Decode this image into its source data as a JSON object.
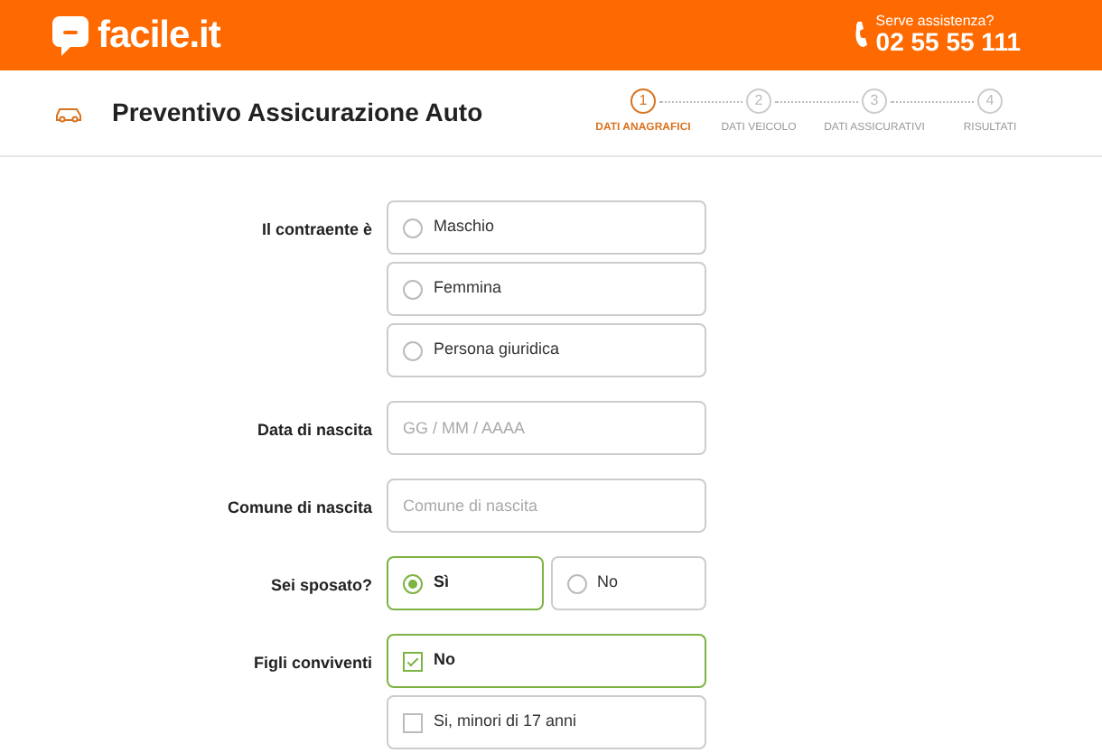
{
  "header": {
    "logo": "facile.it",
    "help_label": "Serve assistenza?",
    "phone": "02 55 55 111"
  },
  "page_title": "Preventivo Assicurazione Auto",
  "steps": [
    {
      "number": "1",
      "label": "DATI ANAGRAFICI",
      "selected": true
    },
    {
      "number": "2",
      "label": "DATI VEICOLO",
      "selected": false
    },
    {
      "number": "3",
      "label": "DATI ASSICURATIVI",
      "selected": false
    },
    {
      "number": "4",
      "label": "RISULTATI",
      "selected": false
    }
  ],
  "form": [
    {
      "label": "Il contraente è",
      "kind": "radio-stack",
      "options": [
        {
          "label": "Maschio",
          "selected": false
        },
        {
          "label": "Femmina",
          "selected": false
        },
        {
          "label": "Persona giuridica",
          "selected": false
        }
      ]
    },
    {
      "label": "Data di nascita",
      "kind": "input",
      "placeholder": "GG / MM / AAAA"
    },
    {
      "label": "Comune di nascita",
      "kind": "input",
      "placeholder": "Comune di nascita"
    },
    {
      "label": "Sei sposato?",
      "kind": "radio-row",
      "options": [
        {
          "label": "Sì",
          "selected": true
        },
        {
          "label": "No",
          "selected": false
        }
      ]
    },
    {
      "label": "Figli conviventi",
      "kind": "checkbox-stack",
      "options": [
        {
          "label": "No",
          "checked": true
        },
        {
          "label": "Si, minori di 17 anni",
          "checked": false
        }
      ]
    }
  ]
}
